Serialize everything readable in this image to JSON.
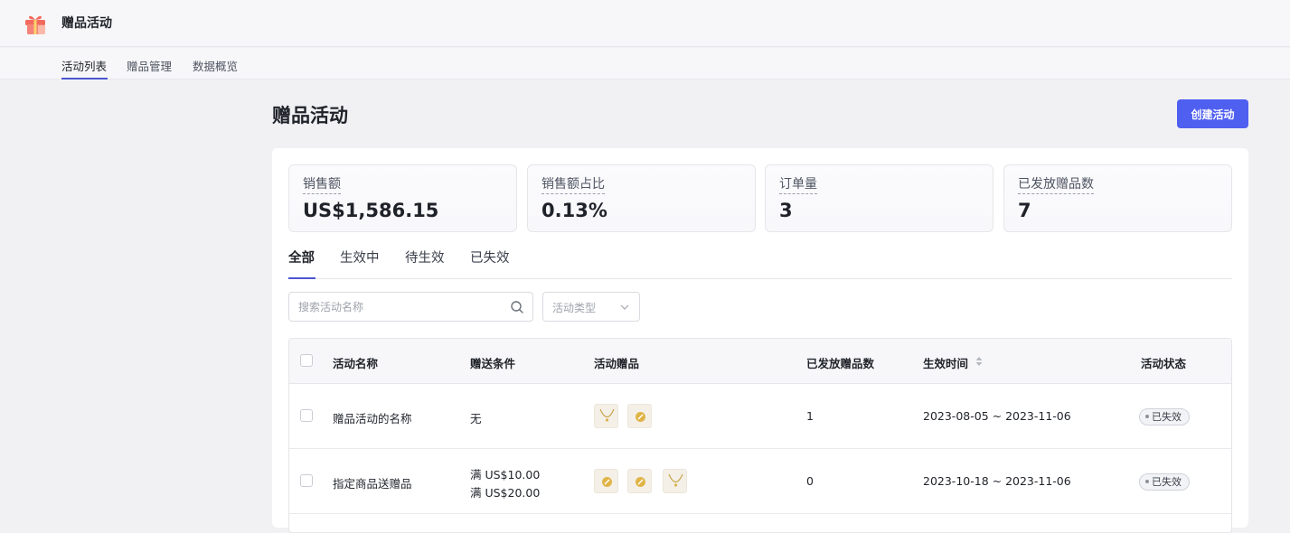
{
  "app": {
    "title": "赠品活动",
    "icon": "gift-icon"
  },
  "subnav": {
    "items": [
      "活动列表",
      "赠品管理",
      "数据概览"
    ],
    "active_index": 0
  },
  "page": {
    "title": "赠品活动",
    "create_button": "创建活动"
  },
  "stats": [
    {
      "label": "销售额",
      "value": "US$1,586.15"
    },
    {
      "label": "销售额占比",
      "value": "0.13%"
    },
    {
      "label": "订单量",
      "value": "3"
    },
    {
      "label": "已发放赠品数",
      "value": "7"
    }
  ],
  "tabs": {
    "items": [
      "全部",
      "生效中",
      "待生效",
      "已失效"
    ],
    "active_index": 0
  },
  "filters": {
    "search_placeholder": "搜索活动名称",
    "type_placeholder": "活动类型"
  },
  "table": {
    "columns": [
      "活动名称",
      "赠送条件",
      "活动赠品",
      "已发放赠品数",
      "生效时间",
      "活动状态"
    ],
    "rows": [
      {
        "name": "赠品活动的名称",
        "conditions": [
          "无"
        ],
        "gifts": [
          "necklace-icon",
          "ring-icon"
        ],
        "issued": "1",
        "time": "2023-08-05 ~ 2023-11-06",
        "status": "已失效"
      },
      {
        "name": "指定商品送赠品",
        "conditions": [
          "满 US$10.00",
          "满 US$20.00"
        ],
        "gifts": [
          "ring-icon",
          "ring-icon",
          "necklace-icon"
        ],
        "issued": "0",
        "time": "2023-10-18 ~ 2023-11-06",
        "status": "已失效"
      }
    ]
  },
  "colors": {
    "accent": "#4f5ff0",
    "tab_underline": "#4d55cf",
    "background": "#f1f1f4"
  }
}
